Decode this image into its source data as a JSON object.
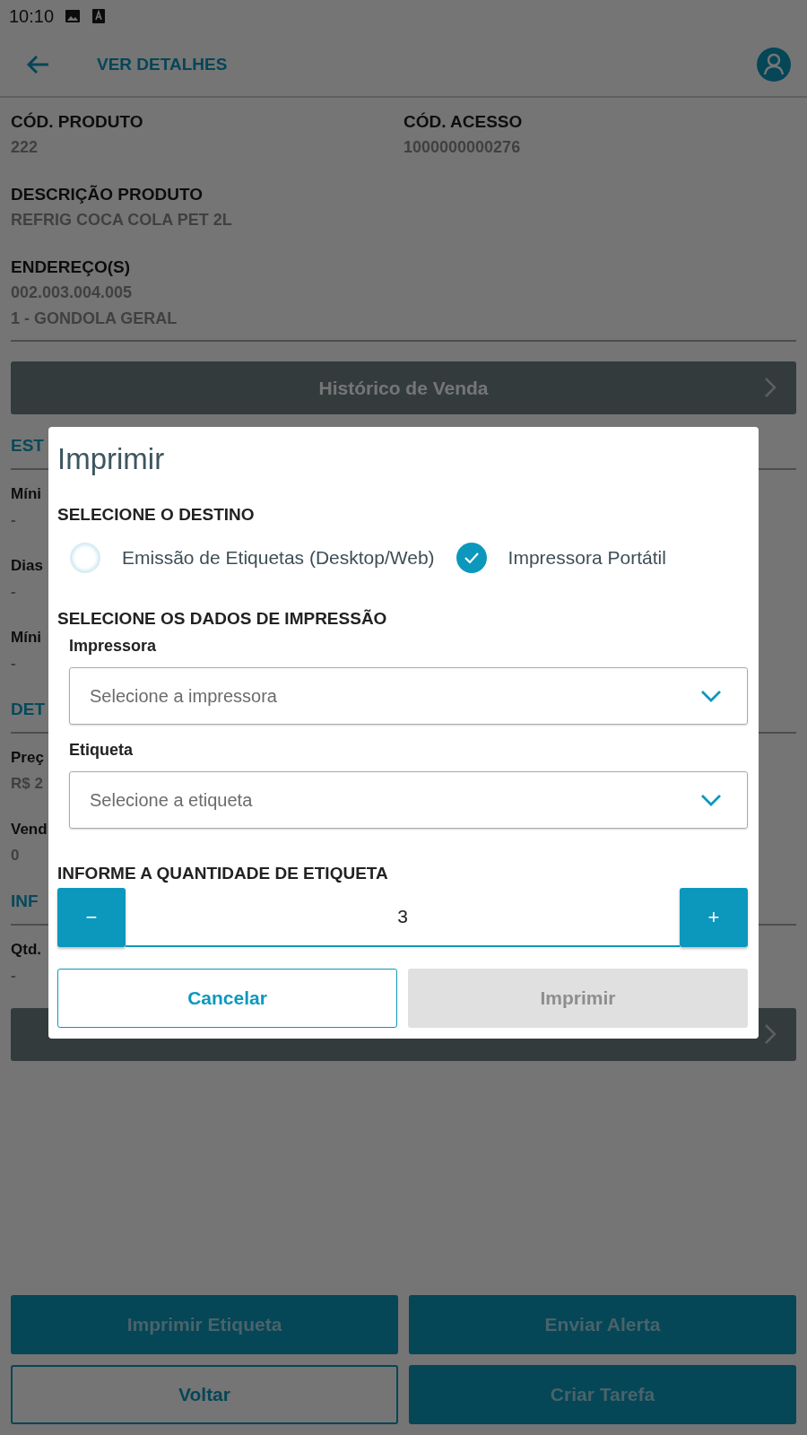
{
  "status_bar": {
    "time": "10:10"
  },
  "header": {
    "title": "VER DETALHES"
  },
  "fields": [
    {
      "label": "CÓD. PRODUTO",
      "values": [
        "222"
      ]
    },
    {
      "label": "CÓD. ACESSO",
      "values": [
        "1000000000276"
      ]
    },
    {
      "label": "DESCRIÇÃO PRODUTO",
      "values": [
        "REFRIG COCA COLA PET 2L"
      ]
    },
    {
      "label": "ENDEREÇO(S)",
      "values": [
        "002.003.004.005",
        "1 - GONDOLA GERAL"
      ]
    }
  ],
  "history_button": {
    "label": "Histórico de Venda"
  },
  "sections": [
    {
      "title": "EST",
      "items": [
        {
          "label": "Míni",
          "value": "-"
        },
        {
          "label": "Dias",
          "value": "-"
        },
        {
          "label": "Míni",
          "value": "-"
        }
      ]
    },
    {
      "title": "DET",
      "items": [
        {
          "label": "Preç",
          "value": "R$ 2"
        },
        {
          "label": "Vend",
          "value": "0"
        }
      ]
    },
    {
      "title": "INF",
      "items": [
        {
          "label": "Qtd.",
          "value": "-"
        }
      ]
    }
  ],
  "actions": [
    {
      "label": "Imprimir Etiqueta",
      "kind": "filled"
    },
    {
      "label": "Enviar Alerta",
      "kind": "filled"
    },
    {
      "label": "Voltar",
      "kind": "outline"
    },
    {
      "label": "Criar Tarefa",
      "kind": "filled"
    }
  ],
  "dialog": {
    "title": "Imprimir",
    "destination_heading": "SELECIONE O DESTINO",
    "destinations": [
      {
        "label": "Emissão de Etiquetas (Desktop/Web)",
        "selected": false
      },
      {
        "label": "Impressora Portátil",
        "selected": true
      }
    ],
    "data_heading": "SELECIONE OS DADOS DE IMPRESSÃO",
    "fields": [
      {
        "label": "Impressora",
        "placeholder": "Selecione a impressora"
      },
      {
        "label": "Etiqueta",
        "placeholder": "Selecione a etiqueta"
      }
    ],
    "quantity_heading": "INFORME A QUANTIDADE DE ETIQUETA",
    "quantity": {
      "decrement": "−",
      "value": "3",
      "increment": "+"
    },
    "buttons": [
      {
        "label": "Cancelar",
        "kind": "outline",
        "disabled": false
      },
      {
        "label": "Imprimir",
        "kind": "filled",
        "disabled": true
      }
    ]
  }
}
